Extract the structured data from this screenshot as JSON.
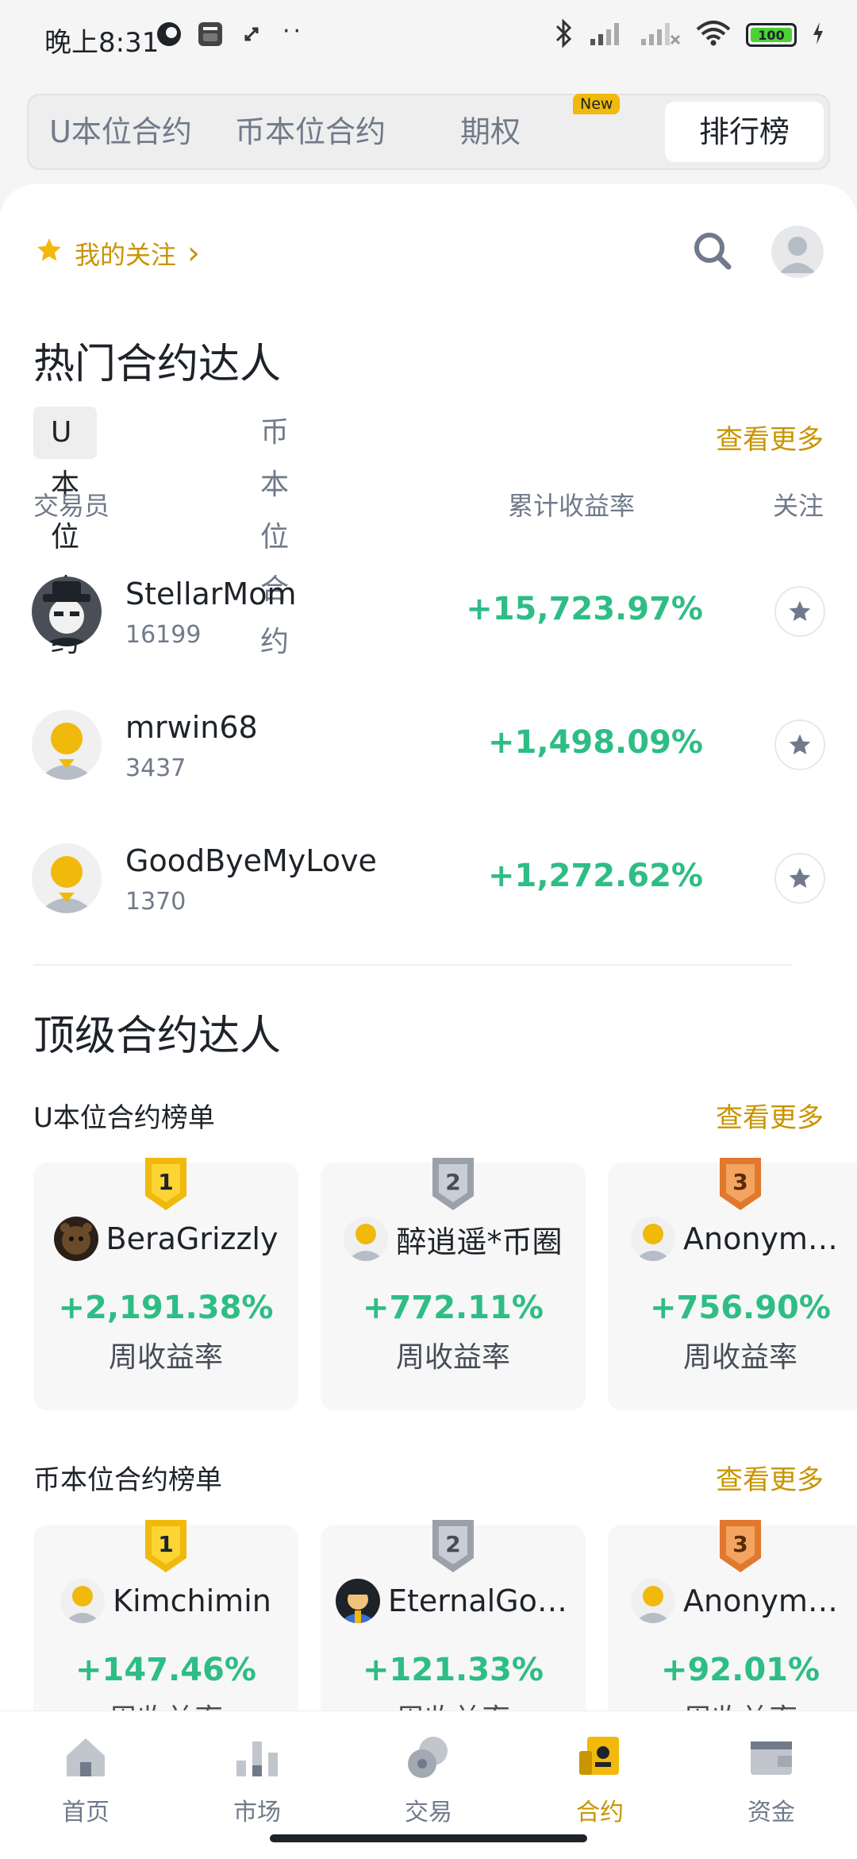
{
  "status_bar": {
    "time": "晚上8:31",
    "battery": "100",
    "dots": "··"
  },
  "top_tabs": [
    {
      "label": "U本位合约"
    },
    {
      "label": "币本位合约"
    },
    {
      "label": "期权",
      "badge": "New"
    },
    {
      "label": "排行榜",
      "active": true
    }
  ],
  "watchlist": {
    "label": "我的关注",
    "arrow": "›"
  },
  "hot": {
    "title": "热门合约达人",
    "tabs": [
      {
        "label": "U本位合约",
        "active": true
      },
      {
        "label": "币本位合约"
      }
    ],
    "more": "查看更多",
    "columns": {
      "trader": "交易员",
      "roi": "累计收益率",
      "follow": "关注"
    },
    "traders": [
      {
        "name": "StellarMom",
        "count": "16199",
        "roi": "+15,723.97%"
      },
      {
        "name": "mrwin68",
        "count": "3437",
        "roi": "+1,498.09%"
      },
      {
        "name": "GoodByeMyLove",
        "count": "1370",
        "roi": "+1,272.62%"
      }
    ]
  },
  "top": {
    "title": "顶级合约达人",
    "usdm": {
      "title": "U本位合约榜单",
      "more": "查看更多",
      "cards": [
        {
          "rank": "1",
          "name": "BeraGrizzly",
          "roi": "+2,191.38%",
          "label": "周收益率"
        },
        {
          "rank": "2",
          "name": "醉逍遥*币圈",
          "roi": "+772.11%",
          "label": "周收益率"
        },
        {
          "rank": "3",
          "name": "Anonymou...",
          "roi": "+756.90%",
          "label": "周收益率"
        }
      ]
    },
    "coinm": {
      "title": "币本位合约榜单",
      "more": "查看更多",
      "cards": [
        {
          "rank": "1",
          "name": "Kimchimin",
          "roi": "+147.46%",
          "label": "周收益率"
        },
        {
          "rank": "2",
          "name": "EternalGol...",
          "roi": "+121.33%",
          "label": "周收益率"
        },
        {
          "rank": "3",
          "name": "Anonymou...",
          "roi": "+92.01%",
          "label": "周收益率"
        }
      ]
    }
  },
  "bottom_nav": [
    {
      "label": "首页",
      "icon": "home-icon"
    },
    {
      "label": "市场",
      "icon": "market-icon"
    },
    {
      "label": "交易",
      "icon": "trade-icon"
    },
    {
      "label": "合约",
      "icon": "futures-icon",
      "active": true
    },
    {
      "label": "资金",
      "icon": "wallet-icon"
    }
  ],
  "colors": {
    "accent": "#F0B90B",
    "accent_text": "#C99400",
    "positive": "#2EBD85",
    "secondary": "#707A8A"
  }
}
